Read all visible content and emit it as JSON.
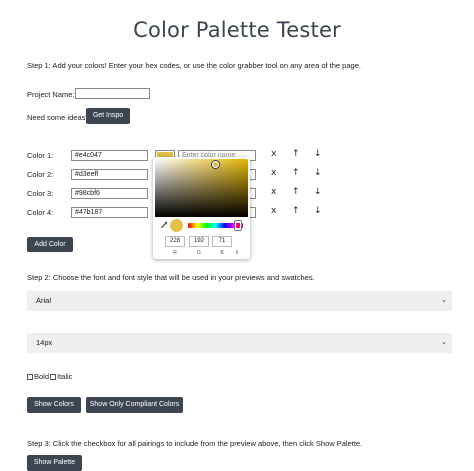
{
  "page": {
    "title": "Color Palette Tester"
  },
  "step1": {
    "text": "Step 1: Add your colors! Enter your hex codes, or use the color grabber tool on any area of the page.",
    "project_label": "Project Name:",
    "project_value": "",
    "ideas_label": "Need some ideas?",
    "inspo_button": "Get Inspo",
    "name_placeholder": "Enter color name",
    "remove_symbol": "x",
    "up_symbol": "↑",
    "down_symbol": "↓",
    "colors": [
      {
        "label": "Color 1:",
        "hex": "#e4c047",
        "swatch": "#e4c047"
      },
      {
        "label": "Color 2:",
        "hex": "#d3eeff",
        "swatch": "#d3eeff"
      },
      {
        "label": "Color 3:",
        "hex": "#98cbf6",
        "swatch": "#98cbf6"
      },
      {
        "label": "Color 4:",
        "hex": "#47b187",
        "swatch": "#47b187"
      }
    ],
    "add_button": "Add Color"
  },
  "picker": {
    "r": "228",
    "g": "192",
    "b": "71",
    "r_label": "R",
    "g_label": "G",
    "b_label": "B",
    "mode_toggle": "⇕",
    "dropper_icon": "eyedropper-icon",
    "color": "#e4c047"
  },
  "step2": {
    "text": "Step 2: Choose the font and font style that will be used in your previews and swatches.",
    "font_value": "Arial",
    "size_value": "14px",
    "bold_label": "Bold",
    "italic_label": "Italic",
    "show_colors_button": "Show Colors",
    "show_compliant_button": "Show Only Compliant Colors"
  },
  "step3": {
    "text": "Step 3: Click the checkbox for all pairings to include from the preview above, then click Show Palette.",
    "show_palette_button": "Show Palette"
  },
  "colors": {
    "button_bg": "#3d4550",
    "select_bg": "#efefef"
  }
}
